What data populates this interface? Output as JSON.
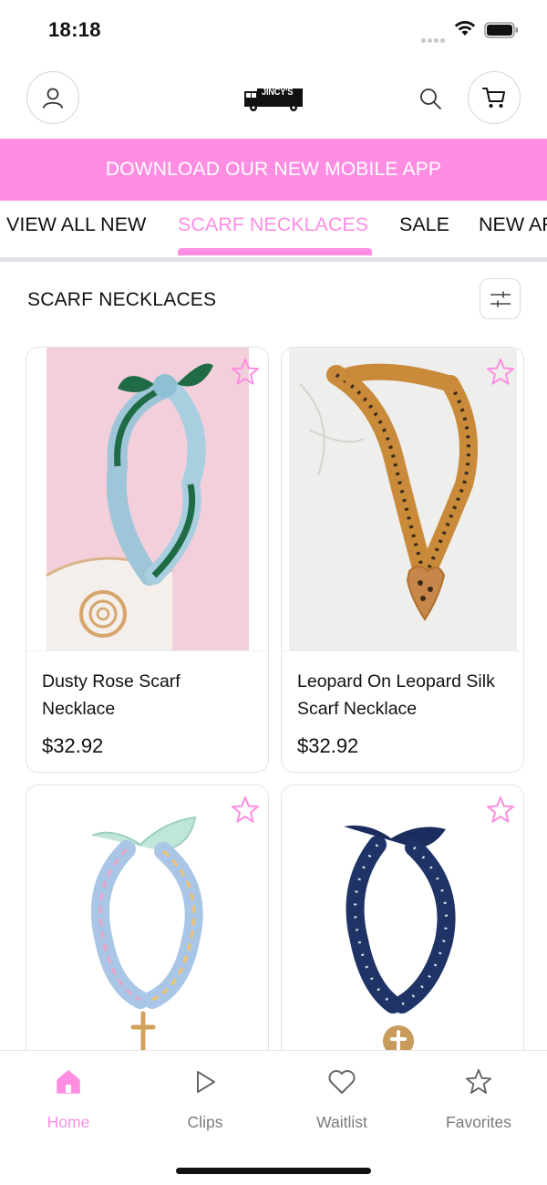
{
  "status_bar": {
    "time": "18:18"
  },
  "header": {
    "logo_text": "JINCY'S"
  },
  "banner": {
    "text": "DOWNLOAD OUR NEW MOBILE APP"
  },
  "tabs": [
    {
      "label": "VIEW ALL NEW",
      "active": false
    },
    {
      "label": "SCARF NECKLACES",
      "active": true
    },
    {
      "label": "SALE",
      "active": false
    },
    {
      "label": "NEW AR",
      "active": false
    }
  ],
  "section": {
    "title": "SCARF NECKLACES"
  },
  "products": [
    {
      "name": "Dusty Rose Scarf Necklace",
      "price": "$32.92"
    },
    {
      "name": "Leopard On Leopard Silk Scarf Necklace",
      "price": "$32.92"
    },
    {
      "name": "",
      "price": ""
    },
    {
      "name": "",
      "price": ""
    }
  ],
  "bottom_nav": [
    {
      "label": "Home",
      "icon": "home-icon",
      "active": true
    },
    {
      "label": "Clips",
      "icon": "play-icon",
      "active": false
    },
    {
      "label": "Waitlist",
      "icon": "heart-icon",
      "active": false
    },
    {
      "label": "Favorites",
      "icon": "star-icon",
      "active": false
    }
  ],
  "colors": {
    "accent": "#ff8ee2",
    "text": "#111111",
    "muted": "#7a7a7a",
    "divider": "#e1e3e6"
  }
}
